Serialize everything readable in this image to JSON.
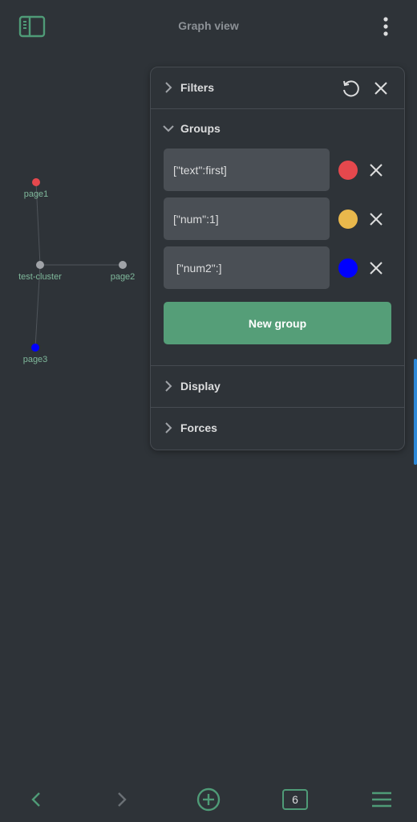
{
  "header": {
    "title": "Graph view",
    "sidebar_toggle_icon": "sidebar-toggle-icon",
    "more_icon": "more-vertical-icon"
  },
  "graph": {
    "nodes": [
      {
        "id": "page1",
        "label": "page1",
        "color": "#e5484d"
      },
      {
        "id": "test-cluster",
        "label": "test-cluster",
        "color": "#a0a3a8"
      },
      {
        "id": "page2",
        "label": "page2",
        "color": "#a0a3a8"
      },
      {
        "id": "page3",
        "label": "page3",
        "color": "#0000ff"
      }
    ]
  },
  "panel": {
    "filters_label": "Filters",
    "groups_label": "Groups",
    "display_label": "Display",
    "forces_label": "Forces",
    "new_group_label": "New group",
    "groups": [
      {
        "query": "[\"text\":first]",
        "color": "#e5484d"
      },
      {
        "query": "[\"num\":1]",
        "color": "#e9b84c"
      },
      {
        "query": " [\"num2\":]",
        "color": "#0000ff"
      }
    ]
  },
  "bottom_nav": {
    "tab_count": "6"
  },
  "colors": {
    "background": "#2e3338",
    "accent": "#559e78",
    "icon_accent": "#4f9b77"
  }
}
